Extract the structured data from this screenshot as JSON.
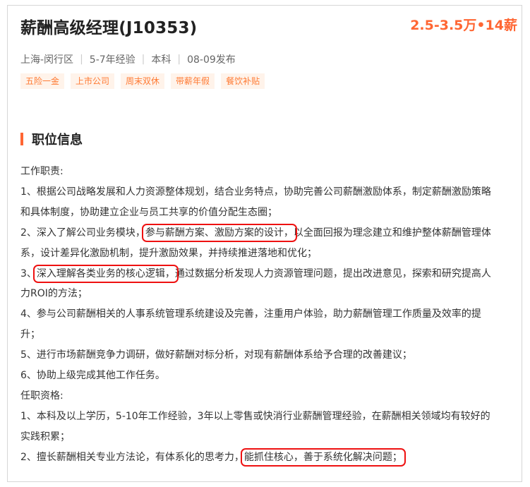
{
  "job": {
    "title": "薪酬高级经理(J10353)",
    "salary": "2.5-3.5万•14薪",
    "location": "上海-闵行区",
    "experience": "5-7年经验",
    "education": "本科",
    "published": "08-09发布",
    "separator": "|"
  },
  "tags": [
    "五险一金",
    "上市公司",
    "周末双休",
    "带薪年假",
    "餐饮补贴"
  ],
  "section": {
    "title": "职位信息"
  },
  "description": {
    "duties_heading": "工作职责:",
    "duty1_l1": "1、根据公司战略发展和人力资源整体规划，结合业务特点，协助完善公司薪酬激励体系，制定薪酬激励策略",
    "duty1_l2": "和具体制度，协助建立企业与员工共享的价值分配生态圈；",
    "duty2_pre": "2、深入了解公司业务模块，",
    "duty2_hl": "参与薪酬方案、激励方案的设计，",
    "duty2_post": "以全面回报为理念建立和维护整体薪酬管理体",
    "duty2_l2": "系，设计差异化激励机制，提升激励效果，并持续推进落地和优化；",
    "duty3_pre": "3、",
    "duty3_hl": "深入理解各类业务的核心逻辑，",
    "duty3_post": "通过数据分析发现人力资源管理问题，提出改进意见，探索和研究提高人",
    "duty3_l2": "力ROI的方法；",
    "duty4_l1": "4、参与公司薪酬相关的人事系统管理系统建设及完善，注重用户体验，助力薪酬管理工作质量及效率的提",
    "duty4_l2": "升；",
    "duty5": "5、进行市场薪酬竞争力调研，做好薪酬对标分析，对现有薪酬体系给予合理的改善建议；",
    "duty6": "6、协助上级完成其他工作任务。",
    "req_heading": "任职资格:",
    "req1_l1": "1、本科及以上学历，5-10年工作经验，3年以上零售或快消行业薪酬管理经验，在薪酬相关领域均有较好的",
    "req1_l2": "实践积累；",
    "req2_pre": "2、擅长薪酬相关专业方法论，有体系化的思考力，",
    "req2_hl": "能抓住核心，善于系统化解决问题；"
  },
  "colors": {
    "accent": "#ff6633",
    "tag_bg": "#fff3ea",
    "highlight_box": "#ee1111"
  }
}
